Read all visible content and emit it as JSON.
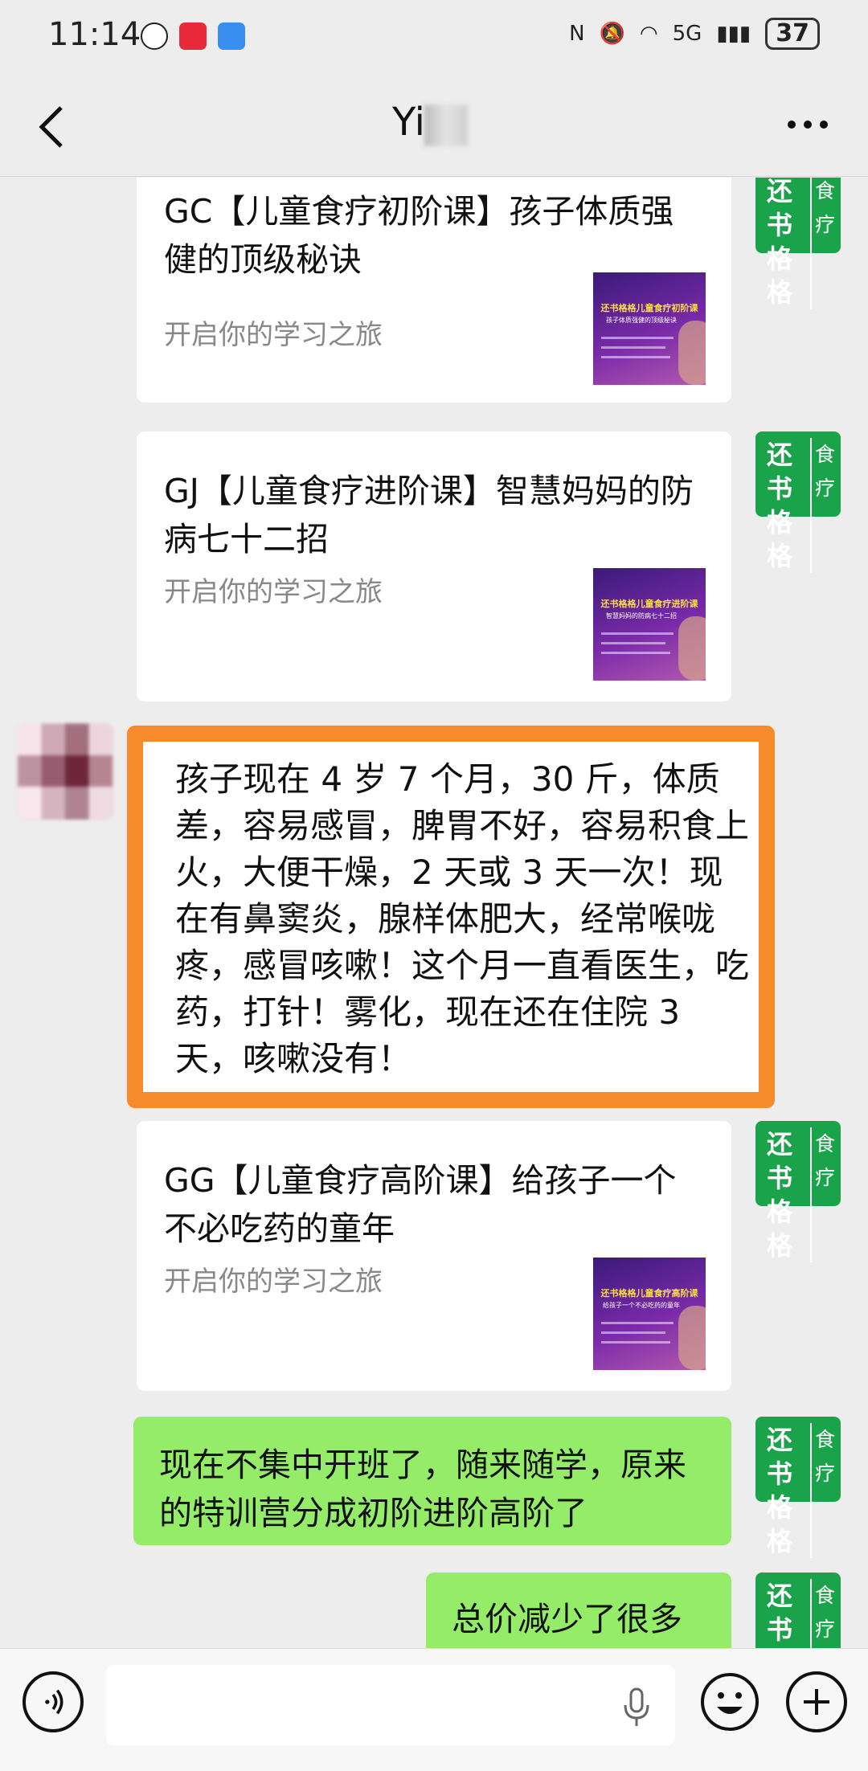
{
  "status_bar": {
    "time": "11:14",
    "signal": "5G",
    "battery": "37"
  },
  "nav": {
    "title": "Yi"
  },
  "cards": [
    {
      "title": "GC【儿童食疗初阶课】孩子体质强健的顶级秘诀",
      "desc": "开启你的学习之旅",
      "thumb_title": "还书格格儿童食疗初阶课",
      "thumb_sub": "孩子体质强健的顶级秘诀"
    },
    {
      "title": "GJ【儿童食疗进阶课】智慧妈妈的防病七十二招",
      "desc": "开启你的学习之旅",
      "thumb_title": "还书格格儿童食疗进阶课",
      "thumb_sub": "智慧妈妈的防病七十二招"
    },
    {
      "title": "GG【儿童食疗高阶课】给孩子一个不必吃药的童年",
      "desc": "开启你的学习之旅",
      "thumb_title": "还书格格儿童食疗高阶课",
      "thumb_sub": "给孩子一个不必吃药的童年"
    }
  ],
  "incoming_message": "孩子现在 4 岁 7 个月，30 斤，体质差，容易感冒，脾胃不好，容易积食上火，大便干燥，2 天或 3 天一次！现在有鼻窦炎，腺样体肥大，经常喉咙疼，感冒咳嗽！这个月一直看医生，吃药，打针！雾化，现在还在住院 3 天，咳嗽没有！",
  "outgoing_messages": [
    "现在不集中开班了，随来随学，原来的特训营分成初阶进阶高阶了",
    "总价减少了很多"
  ],
  "avatar_me": {
    "line1": "还书",
    "line2": "格格",
    "side1": "食",
    "side2": "疗"
  },
  "colors": {
    "highlight": "#f78a2a",
    "bubble_green": "#95ec69",
    "avatar_green": "#1aa34a"
  }
}
